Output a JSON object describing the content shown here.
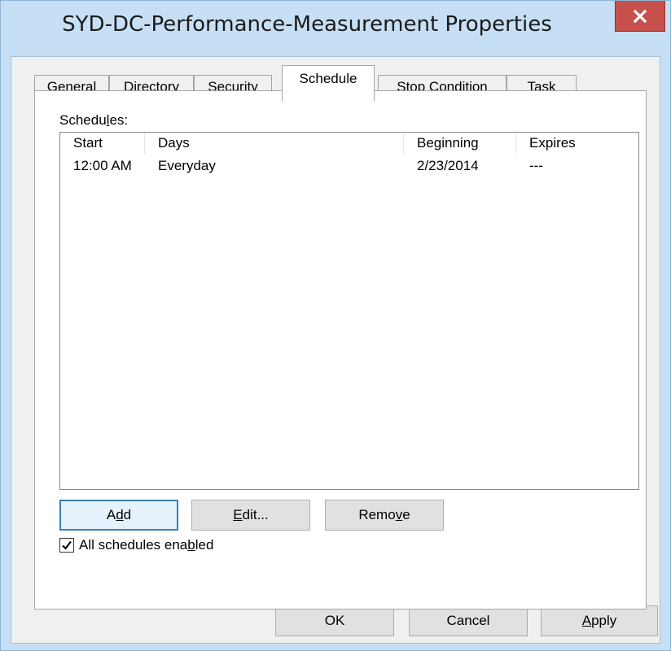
{
  "window": {
    "title": "SYD-DC-Performance-Measurement Properties",
    "close_glyph": "x"
  },
  "tabs": [
    {
      "label": "General",
      "selected": false
    },
    {
      "label": "Directory",
      "selected": false
    },
    {
      "label": "Security",
      "selected": false
    },
    {
      "label": "Schedule",
      "selected": true
    },
    {
      "label": "Stop Condition",
      "selected": false
    },
    {
      "label": "Task",
      "selected": false
    }
  ],
  "schedule_tab": {
    "schedules_label": {
      "pre": "Schedu",
      "accel": "l",
      "post": "es:"
    },
    "columns": [
      "Start",
      "Days",
      "Beginning",
      "Expires"
    ],
    "rows": [
      {
        "start": "12:00 AM",
        "days": "Everyday",
        "beginning": "2/23/2014",
        "expires": "---"
      }
    ],
    "buttons": {
      "add": {
        "pre": "A",
        "accel": "d",
        "post": "d"
      },
      "edit": {
        "pre": "",
        "accel": "E",
        "post": "dit..."
      },
      "remove": {
        "pre": "Remo",
        "accel": "v",
        "post": "e"
      }
    },
    "all_enabled": {
      "checked": true,
      "label": {
        "pre": "All schedules ena",
        "accel": "b",
        "post": "led"
      }
    }
  },
  "footer": {
    "ok": "OK",
    "cancel": "Cancel",
    "apply": {
      "pre": "",
      "accel": "A",
      "post": "pply"
    }
  },
  "colors": {
    "frame": "#c7dff4",
    "close_button": "#c7504c",
    "default_button_border": "#3c7fb1"
  }
}
